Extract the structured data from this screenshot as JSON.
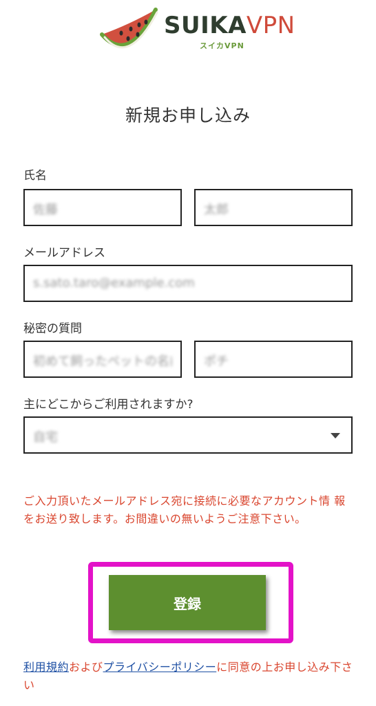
{
  "header": {
    "brand_primary": "SUIKA",
    "brand_secondary": "VPN",
    "brand_sub": "スイカVPN"
  },
  "page": {
    "title": "新規お申し込み"
  },
  "form": {
    "name": {
      "label": "氏名",
      "last_name_value": "佐藤",
      "first_name_value": "太郎"
    },
    "email": {
      "label": "メールアドレス",
      "value": "s.sato.taro@example.com"
    },
    "secret_question": {
      "label": "秘密の質問",
      "question_value": "初めて飼ったペットの名前",
      "answer_value": "ポチ"
    },
    "usage": {
      "label": "主にどこからご利用されますか?",
      "selected_value": "自宅"
    }
  },
  "notice": "ご入力頂いたメールアドレス宛に接続に必要なアカウント情 報をお送り致します。お間違いの無いようご注意下さい。",
  "register_button": "登録",
  "terms": {
    "link_terms": "利用規約",
    "and_text": "および",
    "link_privacy": "プライバシーポリシー",
    "rest_text": "に同意の上お申し込み下さい"
  },
  "colors": {
    "accent_red": "#d9452e",
    "button_green": "#5d8f2f",
    "highlight_magenta": "#e312c8",
    "link_blue": "#1d4fa3"
  }
}
